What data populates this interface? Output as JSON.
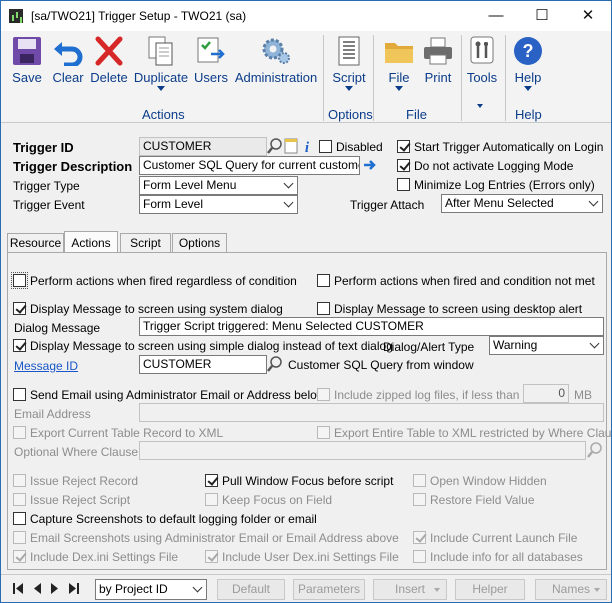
{
  "window": {
    "title": "[sa/TWO21] Trigger Setup  -  TWO21 (sa)",
    "min_glyph": "—",
    "max_glyph": "☐",
    "close_glyph": "✕"
  },
  "ribbon": {
    "buttons": [
      {
        "label": "Save",
        "icon": "save-icon"
      },
      {
        "label": "Clear",
        "icon": "undo-icon"
      },
      {
        "label": "Delete",
        "icon": "delete-icon"
      },
      {
        "label": "Duplicate",
        "icon": "duplicate-icon"
      },
      {
        "label": "Users",
        "icon": "users-icon"
      },
      {
        "label": "Administration",
        "icon": "gear-icon"
      },
      {
        "label": "Script",
        "icon": "script-icon"
      },
      {
        "label": "File",
        "icon": "folder-icon"
      },
      {
        "label": "Print",
        "icon": "printer-icon"
      },
      {
        "label": "Tools",
        "icon": "tools-icon"
      },
      {
        "label": "Help",
        "icon": "help-icon"
      }
    ],
    "groups": {
      "actions": "Actions",
      "options": "Options",
      "file": "File",
      "help": "Help"
    }
  },
  "header": {
    "trigger_id_label": "Trigger ID",
    "trigger_id_value": "CUSTOMER",
    "disabled_label": "Disabled",
    "trigger_description_label": "Trigger Description",
    "trigger_description_value": "Customer SQL Query for current customer",
    "trigger_type_label": "Trigger Type",
    "trigger_type_value": "Form Level Menu",
    "trigger_event_label": "Trigger Event",
    "trigger_event_value": "Form Level",
    "trigger_attach_label": "Trigger Attach",
    "trigger_attach_value": "After Menu Selected",
    "start_auto_label": "Start Trigger Automatically on Login",
    "no_logging_label": "Do not activate Logging Mode",
    "min_log_label": "Minimize Log Entries (Errors only)"
  },
  "tabs": [
    "Resource",
    "Actions",
    "Script",
    "Options"
  ],
  "actions": {
    "perform_regardless": "Perform actions when fired regardless of condition",
    "perform_not_met": "Perform actions when fired and condition not met",
    "display_system_dialog": "Display Message to screen using system dialog",
    "display_desktop_alert": "Display Message to screen using desktop alert",
    "dialog_message_label": "Dialog Message",
    "dialog_message_value": "Trigger Script triggered: Menu Selected CUSTOMER",
    "display_simple_dialog": "Display Message to screen using simple dialog instead of text dialog",
    "dialog_alert_type_label": "Dialog/Alert Type",
    "dialog_alert_type_value": "Warning",
    "message_id_label": "Message ID",
    "message_id_value": "CUSTOMER",
    "message_id_desc": "Customer SQL Query from window",
    "send_email": "Send Email using Administrator Email or Address below",
    "include_zipped": "Include zipped log files, if less than",
    "zip_size": "0",
    "zip_unit": "MB",
    "email_address_label": "Email Address",
    "export_current_table": "Export Current Table Record to XML",
    "export_entire_table": "Export Entire Table to XML restricted by Where Clause",
    "optional_where_label": "Optional Where Clause",
    "issue_reject_record": "Issue Reject Record",
    "pull_window_focus": "Pull Window Focus before script",
    "open_window_hidden": "Open Window Hidden",
    "issue_reject_script": "Issue Reject Script",
    "keep_focus_on_field": "Keep Focus on Field",
    "restore_field_value": "Restore Field Value",
    "capture_screenshots": "Capture Screenshots to default logging folder or email",
    "email_screenshots": "Email Screenshots using Administrator Email or Email Address above",
    "include_current_launch": "Include Current Launch File",
    "include_dex_ini": "Include Dex.ini Settings File",
    "include_user_dex_ini": "Include User Dex.ini Settings File",
    "include_info_all_db": "Include info for all databases"
  },
  "statusbar": {
    "sort_value": "by Project ID",
    "buttons": [
      "Default",
      "Parameters",
      "Insert",
      "Helper",
      "Names"
    ]
  }
}
